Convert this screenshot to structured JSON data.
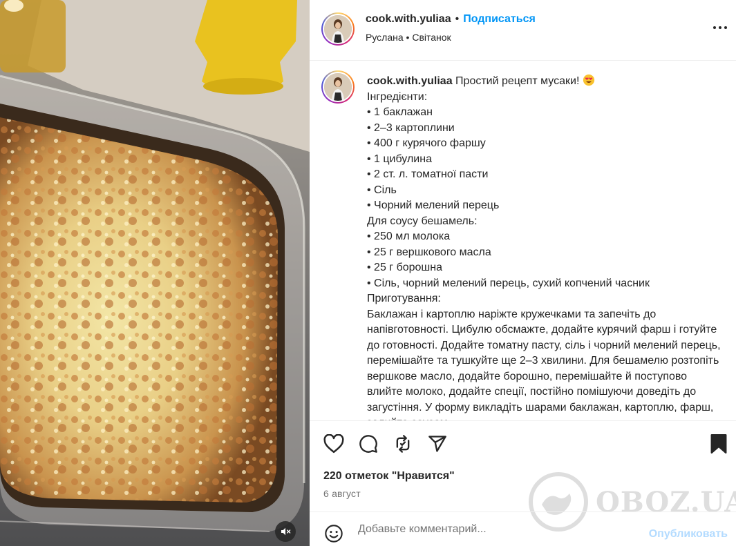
{
  "post": {
    "username": "cook.with.yuliaa",
    "follow_label": "Подписаться",
    "audio_artist": "Руслана",
    "audio_title": "Світанок",
    "caption_lines": [
      "Інгредієнти:",
      "• 1 баклажан",
      "• 2–3 картоплини",
      "• 400 г курячого фаршу",
      "• 1 цибулина",
      "• 2 ст. л. томатної пасти",
      "• Сіль",
      "• Чорний мелений перець",
      "Для соусу бешамель:",
      "• 250 мл молока",
      "• 25 г вершкового масла",
      "• 25 г борошна",
      "• Сіль, чорний мелений перець, сухий копчений часник",
      "Приготування:"
    ],
    "caption_intro": "Простий рецепт мусаки!",
    "caption_method": "Баклажан і картоплю наріжте кружечками та запечіть до напівготовності. Цибулю обсмажте, додайте курячий фарш і готуйте до готовності. Додайте томатну пасту, сіль і чорний мелений перець, перемішайте та тушкуйте ще 2–3 хвилини. Для бешамелю розтопіть вершкове масло, додайте борошно, перемішайте й поступово влийте молоко, додайте спеції, постійно помішуючи доведіть до загустіння. У форму викладіть шарами баклажан, картоплю, фарш, залийте соусом.",
    "likes": "220 отметок \"Нравится\"",
    "date": "6 август"
  },
  "comment": {
    "placeholder": "Добавьте комментарий...",
    "publish_label": "Опубликовать"
  },
  "watermark": {
    "text": "OBOZ.UA"
  },
  "icons": {
    "like": "heart-icon",
    "comment": "comment-icon",
    "repost": "repost-icon",
    "share": "share-icon",
    "save": "bookmark-icon",
    "emoji": "emoji-icon",
    "mute": "mute-icon",
    "more": "more-options-icon"
  },
  "colors": {
    "accent": "#0095f6",
    "publish_disabled": "#b3dbff",
    "text": "#262626",
    "secondary": "#737373",
    "divider": "#efefef"
  }
}
